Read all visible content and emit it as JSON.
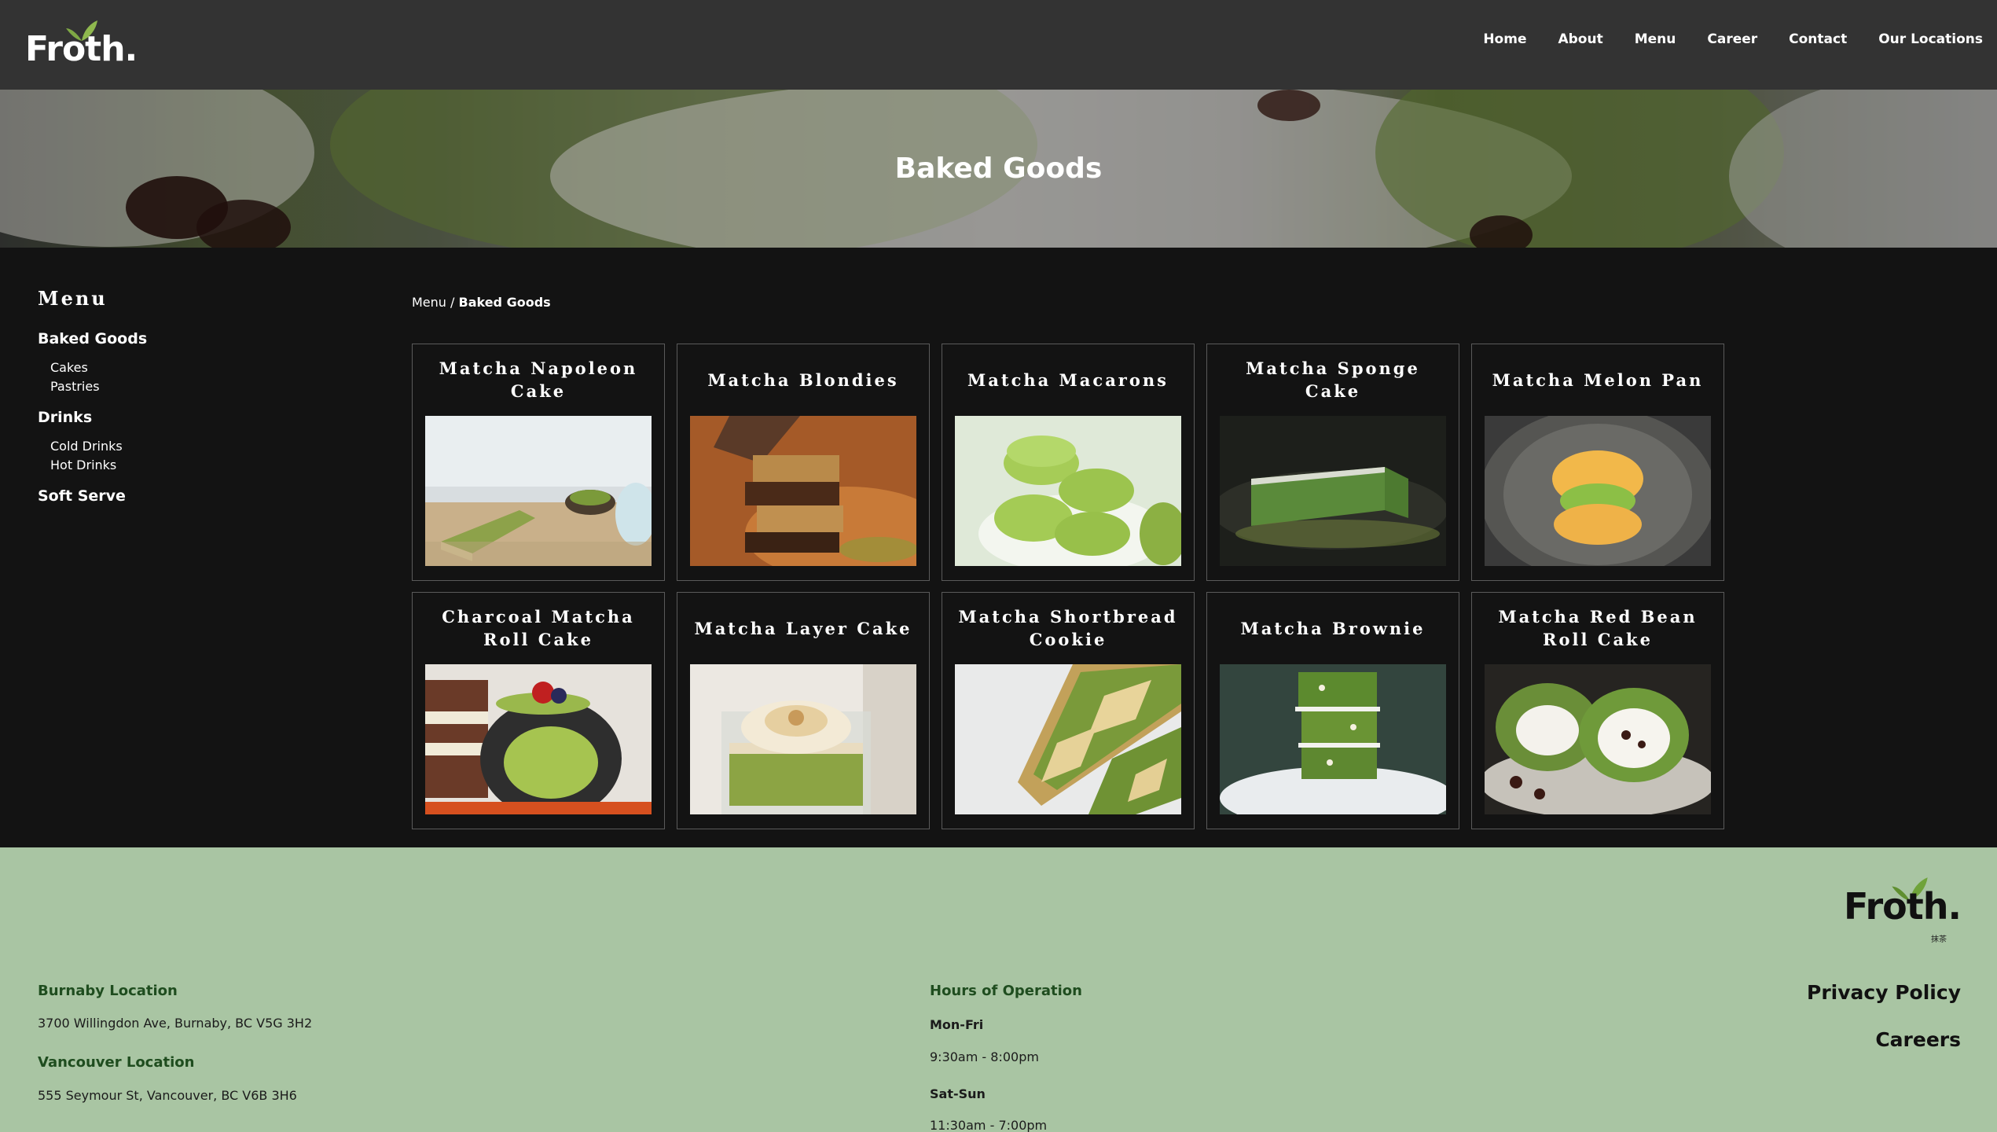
{
  "brand": {
    "name": "Froth.",
    "footer_sub": "抹茶"
  },
  "nav": [
    {
      "label": "Home"
    },
    {
      "label": "About"
    },
    {
      "label": "Menu"
    },
    {
      "label": "Career"
    },
    {
      "label": "Contact"
    },
    {
      "label": "Our Locations"
    }
  ],
  "hero": {
    "title": "Baked Goods"
  },
  "sidebar": {
    "title": "Menu",
    "categories": [
      {
        "label": "Baked Goods",
        "subs": [
          "Cakes",
          "Pastries"
        ]
      },
      {
        "label": "Drinks",
        "subs": [
          "Cold Drinks",
          "Hot Drinks"
        ]
      },
      {
        "label": "Soft Serve",
        "subs": []
      }
    ]
  },
  "breadcrumb": {
    "root": "Menu",
    "separator": " / ",
    "current": "Baked Goods"
  },
  "products": [
    {
      "name": "Matcha Napoleon Cake",
      "image": "napoleon-cake-photo"
    },
    {
      "name": "Matcha Blondies",
      "image": "blondies-photo"
    },
    {
      "name": "Matcha Macarons",
      "image": "macarons-photo"
    },
    {
      "name": "Matcha Sponge Cake",
      "image": "sponge-cake-photo"
    },
    {
      "name": "Matcha Melon Pan",
      "image": "melon-pan-photo"
    },
    {
      "name": "Charcoal Matcha Roll Cake",
      "image": "charcoal-roll-cake-photo"
    },
    {
      "name": "Matcha Layer Cake",
      "image": "layer-cake-photo"
    },
    {
      "name": "Matcha Shortbread Cookie",
      "image": "shortbread-cookie-photo"
    },
    {
      "name": "Matcha Brownie",
      "image": "brownie-photo"
    },
    {
      "name": "Matcha Red Bean Roll Cake",
      "image": "red-bean-roll-cake-photo"
    }
  ],
  "footer": {
    "locations": [
      {
        "title": "Burnaby Location",
        "address": "3700 Willingdon Ave, Burnaby, BC V5G 3H2"
      },
      {
        "title": "Vancouver Location",
        "address": "555 Seymour St, Vancouver, BC V6B 3H6"
      }
    ],
    "hours": {
      "title": "Hours of Operation",
      "rows": [
        {
          "days": "Mon-Fri",
          "time": "9:30am - 8:00pm"
        },
        {
          "days": "Sat-Sun",
          "time": "11:30am - 7:00pm"
        }
      ]
    },
    "links": [
      {
        "label": "Privacy Policy"
      },
      {
        "label": "Careers"
      }
    ]
  },
  "colors": {
    "header_bg": "#333333",
    "main_bg": "#131313",
    "footer_bg": "#a9c5a3",
    "footer_heading": "#1f4d1f",
    "matcha": "#7fa845"
  }
}
